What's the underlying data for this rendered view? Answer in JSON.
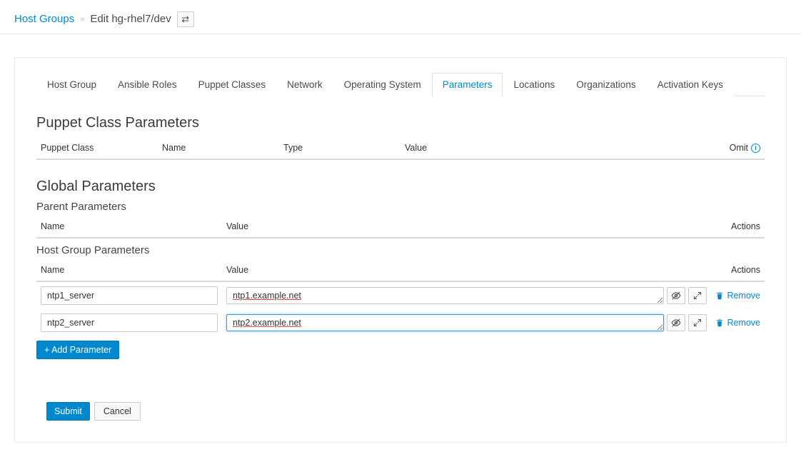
{
  "breadcrumb": {
    "root": "Host Groups",
    "separator": "»",
    "current": "Edit hg-rhel7/dev"
  },
  "tabs": [
    {
      "label": "Host Group",
      "active": false
    },
    {
      "label": "Ansible Roles",
      "active": false
    },
    {
      "label": "Puppet Classes",
      "active": false
    },
    {
      "label": "Network",
      "active": false
    },
    {
      "label": "Operating System",
      "active": false
    },
    {
      "label": "Parameters",
      "active": true
    },
    {
      "label": "Locations",
      "active": false
    },
    {
      "label": "Organizations",
      "active": false
    },
    {
      "label": "Activation Keys",
      "active": false
    }
  ],
  "puppet": {
    "heading": "Puppet Class Parameters",
    "cols": {
      "class": "Puppet Class",
      "name": "Name",
      "type": "Type",
      "value": "Value",
      "omit": "Omit"
    }
  },
  "global": {
    "heading": "Global Parameters",
    "parent_heading": "Parent Parameters",
    "cols": {
      "name": "Name",
      "value": "Value",
      "actions": "Actions"
    }
  },
  "hostgroup": {
    "heading": "Host Group Parameters",
    "cols": {
      "name": "Name",
      "value": "Value",
      "actions": "Actions"
    },
    "rows": [
      {
        "name": "ntp1_server",
        "value": "ntp1.example.net",
        "focused": false
      },
      {
        "name": "ntp2_server",
        "value": "ntp2.example.net",
        "focused": true
      }
    ],
    "remove_label": "Remove",
    "add_label": "+ Add Parameter"
  },
  "form": {
    "submit": "Submit",
    "cancel": "Cancel"
  }
}
